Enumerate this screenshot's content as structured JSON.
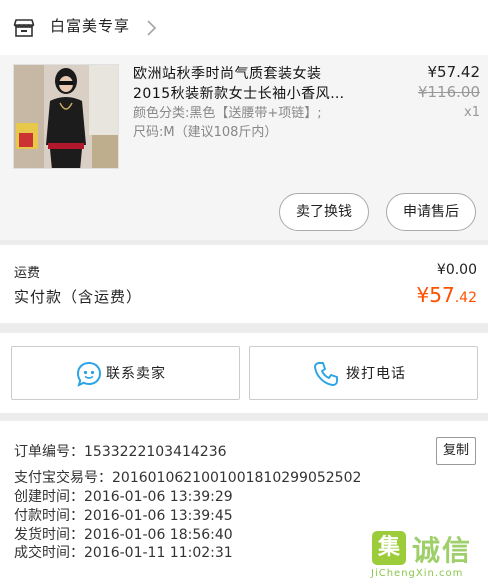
{
  "store": {
    "name": "白富美专享",
    "icon": "store-icon"
  },
  "product": {
    "title_lines": [
      "欧洲站秋季时尚气质套装女装",
      "2015秋装新款女士长袖小香风…"
    ],
    "spec_lines": [
      "颜色分类:黑色【送腰带+项链】;",
      "尺码:M（建议108斤内）"
    ],
    "price": "¥57.42",
    "original_price": "¥116.00",
    "quantity": "x1"
  },
  "actions": {
    "sell_label": "卖了换钱",
    "after_sale_label": "申请售后"
  },
  "totals": {
    "shipping_label": "运费",
    "shipping_value": "¥0.00",
    "paid_label": "实付款（含运费）",
    "paid_symbol": "¥",
    "paid_int": "57",
    "paid_dec": ".42",
    "accent_color": "#ff5000"
  },
  "contact": {
    "seller_label": "联系卖家",
    "call_label": "拨打电话",
    "icon_color": "#2ba4e6"
  },
  "order": {
    "order_no": "订单编号：1533222103414236",
    "copy_label": "复制",
    "alipay_no": "支付宝交易号：2016010621001001810299052502",
    "created": "创建时间：2016-01-06 13:39:29",
    "paid": "付款时间：2016-01-06 13:39:45",
    "shipped": "发货时间：2016-01-06 18:56:40",
    "completed": "成交时间：2016-01-11 11:02:31"
  },
  "watermark": {
    "logo_char": "集",
    "text": "诚信",
    "url": "JiChengXin.com"
  }
}
